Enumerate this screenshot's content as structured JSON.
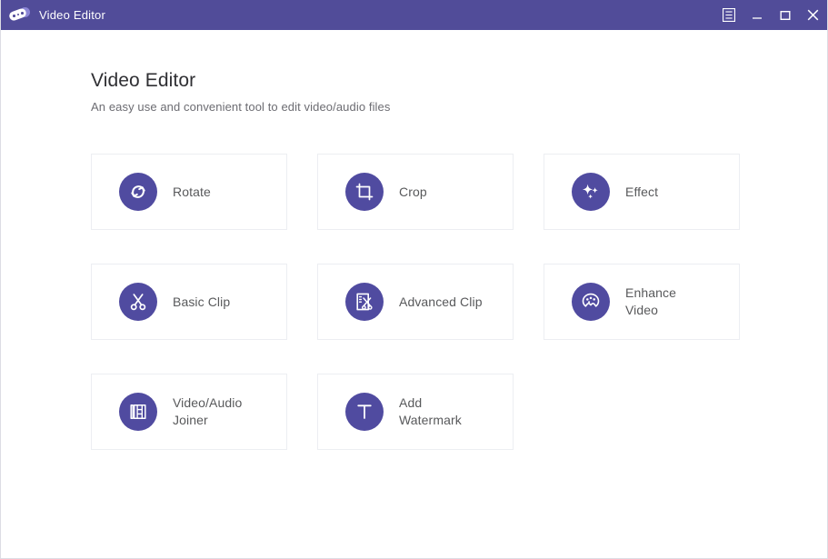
{
  "window": {
    "titlebar": {
      "app_icon": "film-reel-icon",
      "title": "Video Editor",
      "background_color": "#514C99",
      "controls": [
        {
          "name": "menu-button",
          "icon": "list-menu-icon"
        },
        {
          "name": "minimize-button",
          "icon": "minimize-icon"
        },
        {
          "name": "maximize-button",
          "icon": "maximize-icon"
        },
        {
          "name": "close-button",
          "icon": "close-icon"
        }
      ]
    }
  },
  "header": {
    "title": "Video Editor",
    "subtitle": "An easy use and convenient tool to edit video/audio files"
  },
  "theme": {
    "accent": "#504BA0",
    "titlebar": "#514C99",
    "card_border": "#eceef2",
    "label_color": "#58595B"
  },
  "tools": [
    {
      "id": "rotate",
      "label": "Rotate",
      "icon": "rotate-icon"
    },
    {
      "id": "crop",
      "label": "Crop",
      "icon": "crop-icon"
    },
    {
      "id": "effect",
      "label": "Effect",
      "icon": "sparkle-icon"
    },
    {
      "id": "basic-clip",
      "label": "Basic Clip",
      "icon": "scissors-icon"
    },
    {
      "id": "advanced-clip",
      "label": "Advanced Clip",
      "icon": "scissors-frame-icon"
    },
    {
      "id": "enhance-video",
      "label": "Enhance\nVideo",
      "icon": "palette-icon"
    },
    {
      "id": "video-audio-joiner",
      "label": "Video/Audio\nJoiner",
      "icon": "film-stack-icon"
    },
    {
      "id": "add-watermark",
      "label": "Add\nWatermark",
      "icon": "text-t-icon"
    }
  ]
}
